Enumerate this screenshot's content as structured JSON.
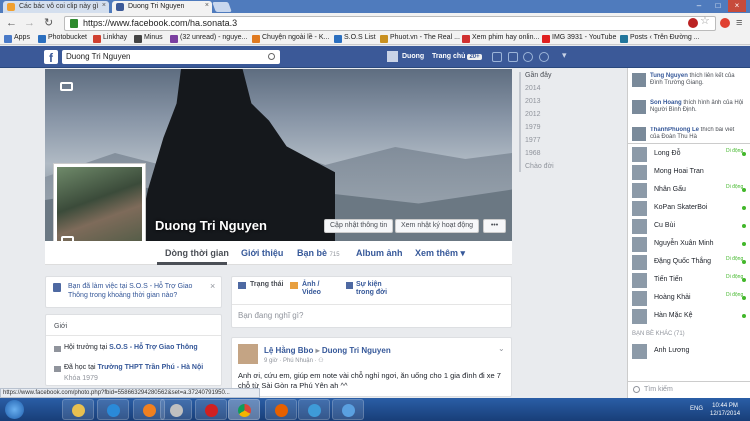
{
  "browser": {
    "tabs": [
      {
        "title": "Các bác vô coi clip này gì",
        "close": "×"
      },
      {
        "title": "Duong Tri Nguyen",
        "close": "×"
      }
    ],
    "url": "https://www.facebook.com/ha.sonata.3",
    "status_url": "https://www.facebook.com/photo.php?fbid=558663294280562&set=a.37240791950..."
  },
  "bookmarks": [
    {
      "label": "Apps",
      "color": "#4a7ac7"
    },
    {
      "label": "Photobucket",
      "color": "#2b6fbf"
    },
    {
      "label": "Linkhay",
      "color": "#d04030"
    },
    {
      "label": "Minus",
      "color": "#444444"
    },
    {
      "label": "(32 unread) - nguye...",
      "color": "#7b3fa0"
    },
    {
      "label": "Chuyện ngoài lề - K...",
      "color": "#e07a20"
    },
    {
      "label": "S.O.S List",
      "color": "#2b6fbf"
    },
    {
      "label": "Phuot.vn - The Real ...",
      "color": "#c89020"
    },
    {
      "label": "Xem phim hay onlin...",
      "color": "#d03030"
    },
    {
      "label": "IMG 3931 - YouTube",
      "color": "#e02020"
    },
    {
      "label": "Posts ‹ Trên Đường ...",
      "color": "#21759b"
    }
  ],
  "fbbar": {
    "logo": "f",
    "search_value": "Duong Tri Nguyen",
    "user": "Duong",
    "home": "Trang chủ",
    "home_badge": "20+"
  },
  "profile": {
    "name": "Duong Tri Nguyen",
    "update_info": "Cập nhật thông tin",
    "activity_log": "Xem nhật ký hoạt động",
    "more_dots": "•••",
    "tabs": [
      {
        "label": "Dòng thời gian",
        "count": ""
      },
      {
        "label": "Giới thiệu",
        "count": ""
      },
      {
        "label": "Bạn bè",
        "count": "715"
      },
      {
        "label": "Album ảnh",
        "count": ""
      },
      {
        "label": "Xem thêm ▾",
        "count": ""
      }
    ]
  },
  "left": {
    "prompt": "Bạn đã làm việc tại S.O.S - Hỗ Trợ Giao Thông trong khoảng thời gian nào?",
    "close": "×",
    "intro_title": "Giới",
    "rows": [
      {
        "prefix": "Hội trưởng tại ",
        "link": "S.O.S - Hỗ Trợ Giao Thông",
        "sub": ""
      },
      {
        "prefix": "Đã học tại ",
        "link": "Trường THPT Trần Phú - Hà Nội",
        "sub": "Khóa 1979"
      }
    ]
  },
  "composer": {
    "status": "Trạng thái",
    "photo": "Ảnh / Video",
    "event": "Sự kiện trong đời",
    "placeholder": "Bạn đang nghĩ gì?"
  },
  "post": {
    "author": "Lệ Hằng Bbo",
    "arrow": "▸",
    "target": "Duong Tri Nguyen",
    "meta": "9 giờ · Phú Nhuận · ⚇",
    "text": "Anh ơi, cứu em, giúp em note vài chỗ nghỉ ngơi, ăn uống cho 1 gia đình đi xe 7 chỗ từ Sài Gòn ra Phú Yên ah ^^",
    "chevron": "⌄"
  },
  "years": [
    "Gần đây",
    "2014",
    "2013",
    "2012",
    "1979",
    "1977",
    "1968",
    "Chào đời"
  ],
  "ticker": [
    {
      "name": "Tung Nguyen",
      "text": " thích liên kết của Đình Trường Giang."
    },
    {
      "name": "Son Hoang",
      "text": " thích hình ảnh của Hội Người Bình Định."
    },
    {
      "name": "ThanhPhuong Le",
      "text": " thích bài viết của Đoàn Thu Hà"
    }
  ],
  "chat_online_label": "Di động",
  "chat": [
    "Long Đỗ",
    "Mong Hoai Tran",
    "Nhân Gấu",
    "KoPan SkaterBoi",
    "Cu Bùi",
    "Nguyễn Xuân Minh",
    "Đặng Quốc Thắng",
    "Tiến Tiến",
    "Hoàng Khải",
    "Hàn Mặc Kệ"
  ],
  "chat_other_header": "BẠN BÈ KHÁC (71)",
  "chat_other": [
    "Anh Lương"
  ],
  "chat_search": "Tìm kiếm",
  "taskbar": {
    "lang": "ENG",
    "time": "10:44 PM",
    "date": "12/17/2014"
  }
}
